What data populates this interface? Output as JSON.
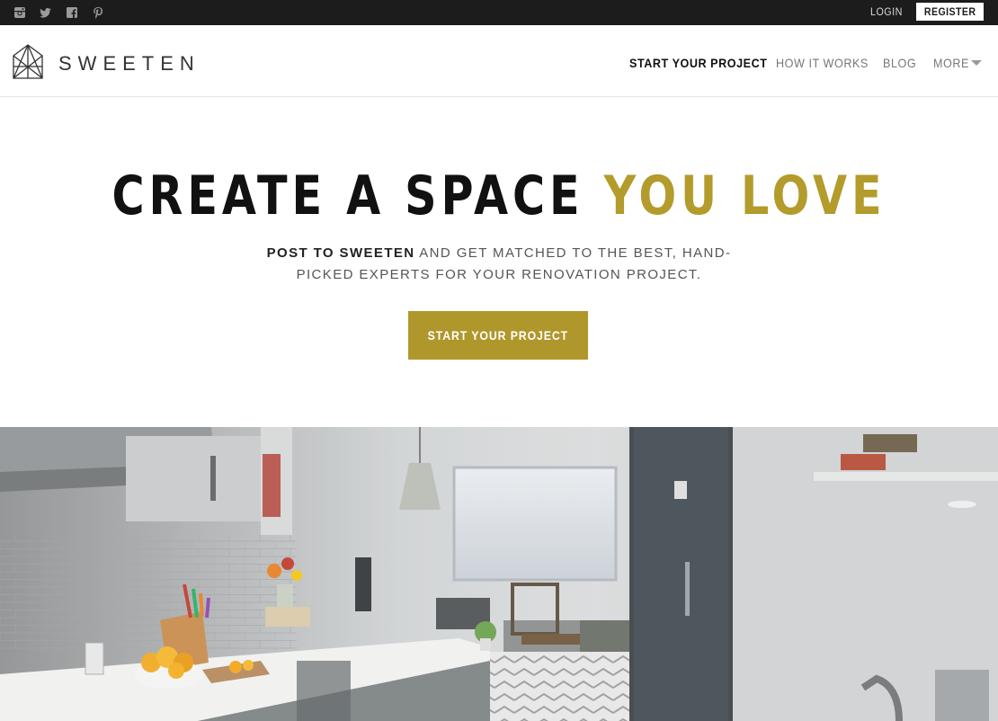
{
  "topbar": {
    "social": [
      {
        "icon": "instagram-icon"
      },
      {
        "icon": "twitter-icon"
      },
      {
        "icon": "facebook-icon"
      },
      {
        "icon": "pinterest-icon"
      }
    ],
    "login": "LOGIN",
    "register": "REGISTER"
  },
  "header": {
    "logo_text": "SWEETEN",
    "nav": [
      "START YOUR PROJECT",
      "HOW IT WORKS",
      "BLOG",
      "MORE"
    ]
  },
  "hero": {
    "title_main": "CREATE A SPACE",
    "title_accent": "YOU LOVE",
    "subtitle_bold": "POST TO SWEETEN",
    "subtitle_line1": "AND GET MATCHED TO THE BEST, HAND-",
    "subtitle_line2": "PICKED EXPERTS FOR YOUR RENOVATION PROJECT.",
    "cta": "START YOUR PROJECT"
  },
  "colors": {
    "accent_gold": "#b39b2c",
    "topbar_bg": "#1c1c1c"
  }
}
